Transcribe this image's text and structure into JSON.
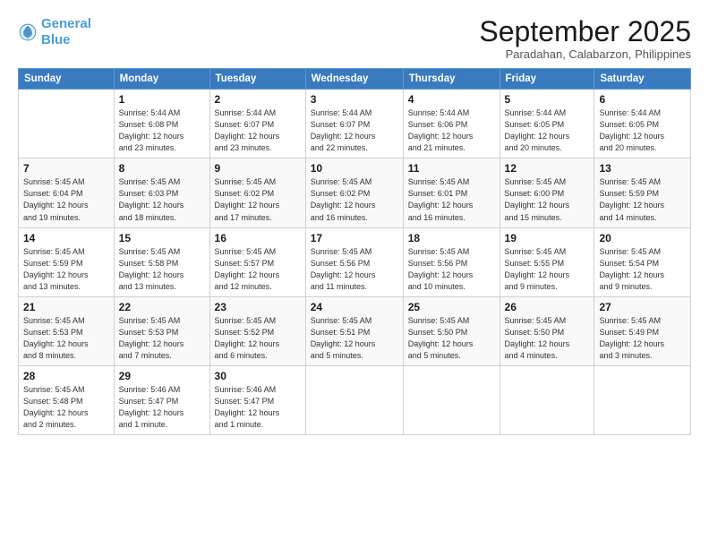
{
  "logo": {
    "line1": "General",
    "line2": "Blue"
  },
  "header": {
    "month": "September 2025",
    "location": "Paradahan, Calabarzon, Philippines"
  },
  "weekdays": [
    "Sunday",
    "Monday",
    "Tuesday",
    "Wednesday",
    "Thursday",
    "Friday",
    "Saturday"
  ],
  "weeks": [
    [
      {
        "day": "",
        "info": ""
      },
      {
        "day": "1",
        "info": "Sunrise: 5:44 AM\nSunset: 6:08 PM\nDaylight: 12 hours\nand 23 minutes."
      },
      {
        "day": "2",
        "info": "Sunrise: 5:44 AM\nSunset: 6:07 PM\nDaylight: 12 hours\nand 23 minutes."
      },
      {
        "day": "3",
        "info": "Sunrise: 5:44 AM\nSunset: 6:07 PM\nDaylight: 12 hours\nand 22 minutes."
      },
      {
        "day": "4",
        "info": "Sunrise: 5:44 AM\nSunset: 6:06 PM\nDaylight: 12 hours\nand 21 minutes."
      },
      {
        "day": "5",
        "info": "Sunrise: 5:44 AM\nSunset: 6:05 PM\nDaylight: 12 hours\nand 20 minutes."
      },
      {
        "day": "6",
        "info": "Sunrise: 5:44 AM\nSunset: 6:05 PM\nDaylight: 12 hours\nand 20 minutes."
      }
    ],
    [
      {
        "day": "7",
        "info": "Sunrise: 5:45 AM\nSunset: 6:04 PM\nDaylight: 12 hours\nand 19 minutes."
      },
      {
        "day": "8",
        "info": "Sunrise: 5:45 AM\nSunset: 6:03 PM\nDaylight: 12 hours\nand 18 minutes."
      },
      {
        "day": "9",
        "info": "Sunrise: 5:45 AM\nSunset: 6:02 PM\nDaylight: 12 hours\nand 17 minutes."
      },
      {
        "day": "10",
        "info": "Sunrise: 5:45 AM\nSunset: 6:02 PM\nDaylight: 12 hours\nand 16 minutes."
      },
      {
        "day": "11",
        "info": "Sunrise: 5:45 AM\nSunset: 6:01 PM\nDaylight: 12 hours\nand 16 minutes."
      },
      {
        "day": "12",
        "info": "Sunrise: 5:45 AM\nSunset: 6:00 PM\nDaylight: 12 hours\nand 15 minutes."
      },
      {
        "day": "13",
        "info": "Sunrise: 5:45 AM\nSunset: 5:59 PM\nDaylight: 12 hours\nand 14 minutes."
      }
    ],
    [
      {
        "day": "14",
        "info": "Sunrise: 5:45 AM\nSunset: 5:59 PM\nDaylight: 12 hours\nand 13 minutes."
      },
      {
        "day": "15",
        "info": "Sunrise: 5:45 AM\nSunset: 5:58 PM\nDaylight: 12 hours\nand 13 minutes."
      },
      {
        "day": "16",
        "info": "Sunrise: 5:45 AM\nSunset: 5:57 PM\nDaylight: 12 hours\nand 12 minutes."
      },
      {
        "day": "17",
        "info": "Sunrise: 5:45 AM\nSunset: 5:56 PM\nDaylight: 12 hours\nand 11 minutes."
      },
      {
        "day": "18",
        "info": "Sunrise: 5:45 AM\nSunset: 5:56 PM\nDaylight: 12 hours\nand 10 minutes."
      },
      {
        "day": "19",
        "info": "Sunrise: 5:45 AM\nSunset: 5:55 PM\nDaylight: 12 hours\nand 9 minutes."
      },
      {
        "day": "20",
        "info": "Sunrise: 5:45 AM\nSunset: 5:54 PM\nDaylight: 12 hours\nand 9 minutes."
      }
    ],
    [
      {
        "day": "21",
        "info": "Sunrise: 5:45 AM\nSunset: 5:53 PM\nDaylight: 12 hours\nand 8 minutes."
      },
      {
        "day": "22",
        "info": "Sunrise: 5:45 AM\nSunset: 5:53 PM\nDaylight: 12 hours\nand 7 minutes."
      },
      {
        "day": "23",
        "info": "Sunrise: 5:45 AM\nSunset: 5:52 PM\nDaylight: 12 hours\nand 6 minutes."
      },
      {
        "day": "24",
        "info": "Sunrise: 5:45 AM\nSunset: 5:51 PM\nDaylight: 12 hours\nand 5 minutes."
      },
      {
        "day": "25",
        "info": "Sunrise: 5:45 AM\nSunset: 5:50 PM\nDaylight: 12 hours\nand 5 minutes."
      },
      {
        "day": "26",
        "info": "Sunrise: 5:45 AM\nSunset: 5:50 PM\nDaylight: 12 hours\nand 4 minutes."
      },
      {
        "day": "27",
        "info": "Sunrise: 5:45 AM\nSunset: 5:49 PM\nDaylight: 12 hours\nand 3 minutes."
      }
    ],
    [
      {
        "day": "28",
        "info": "Sunrise: 5:45 AM\nSunset: 5:48 PM\nDaylight: 12 hours\nand 2 minutes."
      },
      {
        "day": "29",
        "info": "Sunrise: 5:46 AM\nSunset: 5:47 PM\nDaylight: 12 hours\nand 1 minute."
      },
      {
        "day": "30",
        "info": "Sunrise: 5:46 AM\nSunset: 5:47 PM\nDaylight: 12 hours\nand 1 minute."
      },
      {
        "day": "",
        "info": ""
      },
      {
        "day": "",
        "info": ""
      },
      {
        "day": "",
        "info": ""
      },
      {
        "day": "",
        "info": ""
      }
    ]
  ]
}
